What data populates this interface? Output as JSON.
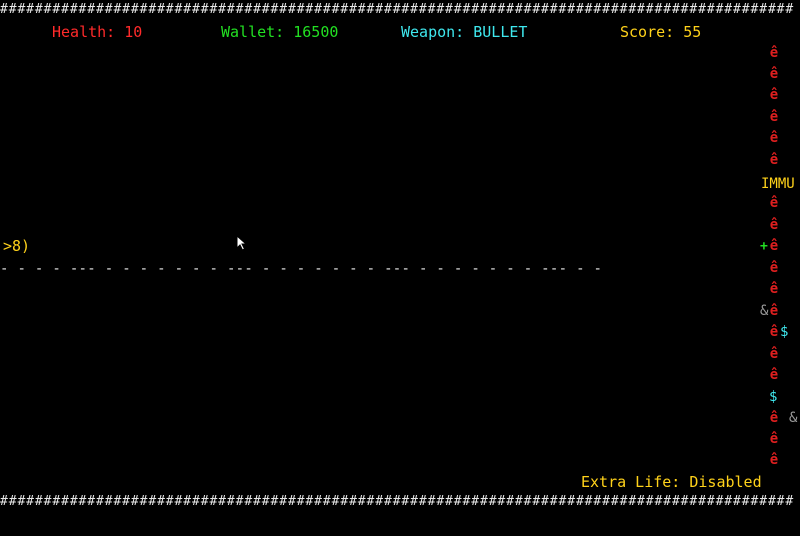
{
  "hud": {
    "health": "Health: 10",
    "wallet": "Wallet: 16500",
    "weapon": "Weapon: BULLET",
    "score": "Score: 55"
  },
  "player": {
    "glyph": ">8)"
  },
  "world": {
    "top_border": "###########################################################################################",
    "bottom_border": "###########################################################################################",
    "divider": "- - - - --- - - - - - - - --- - - - - - - - --- - - - - - - - --- - -"
  },
  "entities": {
    "enemy_glyph": "ê",
    "enemies": [
      {
        "glyph": "ê"
      },
      {
        "glyph": "ê"
      },
      {
        "glyph": "ê"
      },
      {
        "glyph": "ê"
      },
      {
        "glyph": "ê"
      },
      {
        "glyph": "ê"
      },
      {
        "glyph": "ê"
      },
      {
        "glyph": "ê"
      },
      {
        "glyph": "ê"
      },
      {
        "glyph": "ê"
      },
      {
        "glyph": "ê"
      },
      {
        "glyph": "ê"
      },
      {
        "glyph": "ê"
      },
      {
        "glyph": "ê"
      },
      {
        "glyph": "ê"
      },
      {
        "glyph": "ê"
      },
      {
        "glyph": "ê"
      },
      {
        "glyph": "ê"
      },
      {
        "glyph": "ê"
      },
      {
        "glyph": "ê"
      }
    ],
    "powerup_label": "IMMU",
    "health_pickup": "+",
    "coin_glyph": "$",
    "mystery_glyph": "&"
  },
  "status": {
    "extra_life": "Extra Life: Disabled"
  },
  "colors": {
    "background": "#000000",
    "border": "#e8e8e8",
    "health": "#ff2a2a",
    "wallet": "#22e022",
    "weapon": "#3fe8ee",
    "score": "#ffd21a",
    "player": "#ffd21a",
    "enemy": "#dd1f1f",
    "coin": "#3fe8ee",
    "mystery": "#9a9a9a"
  },
  "icons": {
    "cursor": "mouse-pointer-icon",
    "enemy": "enemy-glyph-icon",
    "coin": "coin-icon",
    "health": "health-plus-icon",
    "mystery": "mystery-item-icon"
  }
}
